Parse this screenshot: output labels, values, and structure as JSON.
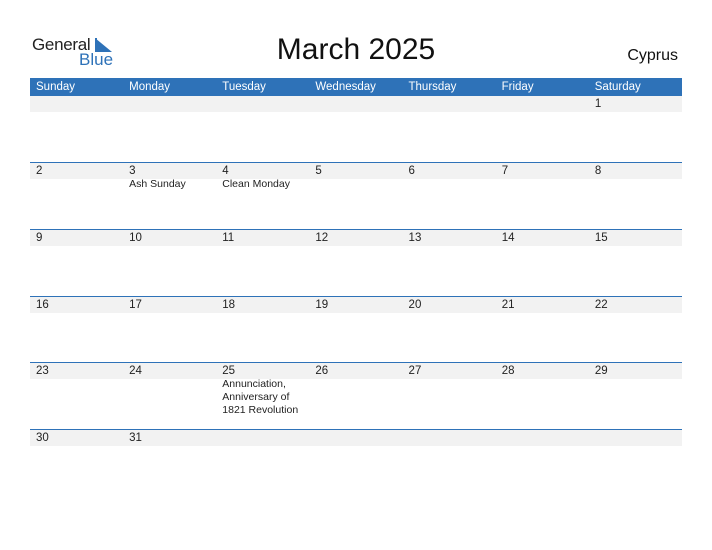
{
  "logo": {
    "general": "General",
    "blue": "Blue"
  },
  "title": "March 2025",
  "country": "Cyprus",
  "colors": {
    "accent": "#2e72b8",
    "band": "#f2f2f2"
  },
  "weekdays": [
    "Sunday",
    "Monday",
    "Tuesday",
    "Wednesday",
    "Thursday",
    "Friday",
    "Saturday"
  ],
  "weeks": [
    [
      {
        "day": ""
      },
      {
        "day": ""
      },
      {
        "day": ""
      },
      {
        "day": ""
      },
      {
        "day": ""
      },
      {
        "day": ""
      },
      {
        "day": "1"
      }
    ],
    [
      {
        "day": "2"
      },
      {
        "day": "3",
        "event": "Ash Sunday"
      },
      {
        "day": "4",
        "event": "Clean Monday"
      },
      {
        "day": "5"
      },
      {
        "day": "6"
      },
      {
        "day": "7"
      },
      {
        "day": "8"
      }
    ],
    [
      {
        "day": "9"
      },
      {
        "day": "10"
      },
      {
        "day": "11"
      },
      {
        "day": "12"
      },
      {
        "day": "13"
      },
      {
        "day": "14"
      },
      {
        "day": "15"
      }
    ],
    [
      {
        "day": "16"
      },
      {
        "day": "17"
      },
      {
        "day": "18"
      },
      {
        "day": "19"
      },
      {
        "day": "20"
      },
      {
        "day": "21"
      },
      {
        "day": "22"
      }
    ],
    [
      {
        "day": "23"
      },
      {
        "day": "24"
      },
      {
        "day": "25",
        "event": "Annunciation, Anniversary of 1821 Revolution"
      },
      {
        "day": "26"
      },
      {
        "day": "27"
      },
      {
        "day": "28"
      },
      {
        "day": "29"
      }
    ],
    [
      {
        "day": "30"
      },
      {
        "day": "31"
      },
      {
        "day": ""
      },
      {
        "day": ""
      },
      {
        "day": ""
      },
      {
        "day": ""
      },
      {
        "day": ""
      }
    ]
  ]
}
